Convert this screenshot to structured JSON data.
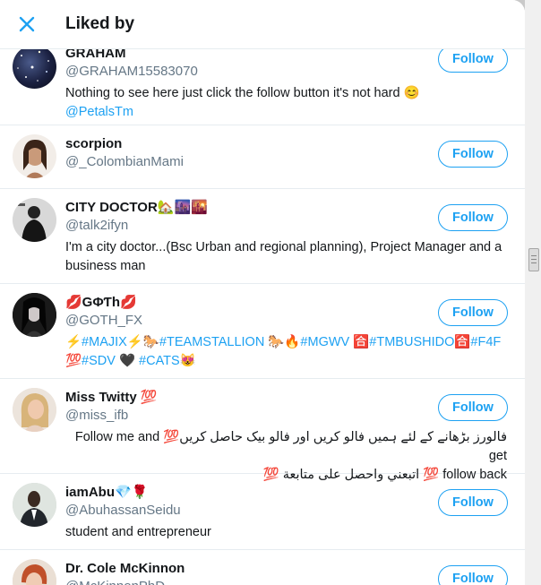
{
  "dialog": {
    "title": "Liked by",
    "close_icon": "close-icon"
  },
  "follow_label": "Follow",
  "colors": {
    "accent": "#1da1f2",
    "text": "#14171a",
    "muted": "#657786"
  },
  "users": [
    {
      "name": "GRAHAM",
      "handle": "@GRAHAM15583070",
      "bio": "Nothing to see here just click the follow button it's not hard 😊",
      "bio_link": "@PetalsTm"
    },
    {
      "name": "scorpion",
      "handle": "@_ColombianMami"
    },
    {
      "name": "CITY DOCTOR🏡🌆🌇",
      "handle": "@talk2ifyn",
      "bio": "I'm a city doctor...(Bsc Urban and regional planning), Project Manager and a business man"
    },
    {
      "name": "💋GΦƬh💋",
      "handle": "@GOTH_FX",
      "bio": "⚡#MAJIX⚡🐎#TEAMSTALLION 🐎🔥#MGWV 🈴#TMBUSHIDO🈴#F4F 💯#SDV 🖤 #CATS😻"
    },
    {
      "name": "Miss Twitty 💯",
      "handle": "@miss_ifb",
      "bio_rtl_1": "فالورز بڑھانے کے لئے ہمیں فالو کریں اور فالو بیک حاصل کریں💯 Follow me and get",
      "bio_rtl_2": "follow back 💯 اتبعني واحصل على متابعة 💯"
    },
    {
      "name": "iamAbu💎🌹",
      "handle": "@AbuhassanSeidu",
      "bio": "student and entrepreneur"
    },
    {
      "name": "Dr. Cole McKinnon",
      "handle": "@McKinnonPhD"
    }
  ]
}
